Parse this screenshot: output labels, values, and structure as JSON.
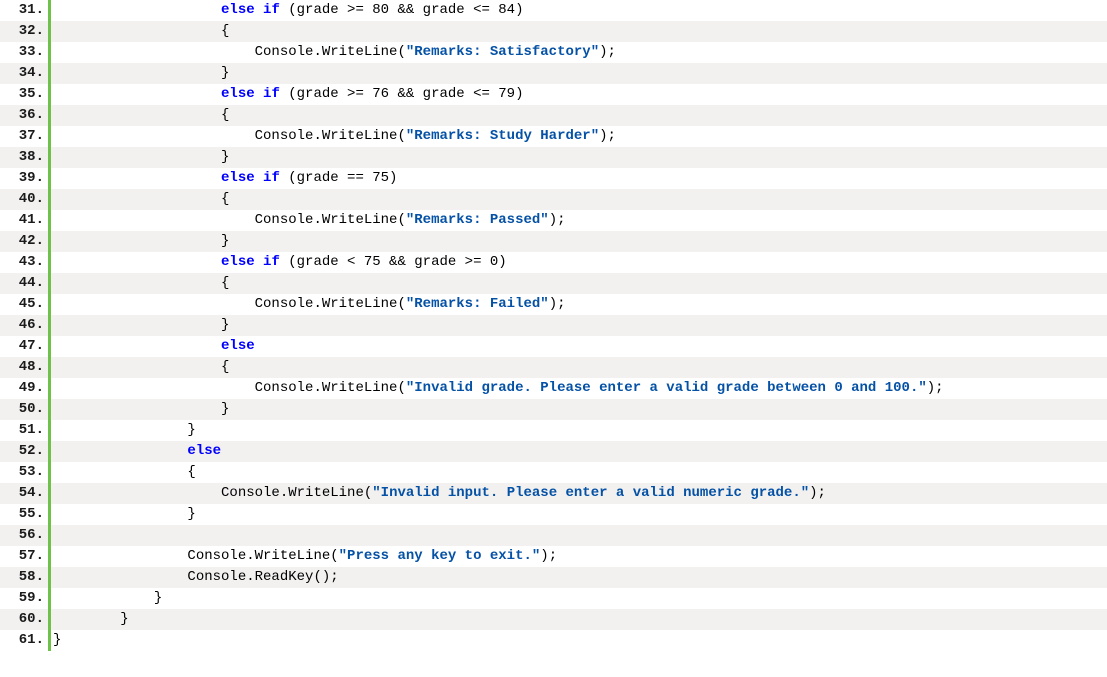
{
  "lines": [
    {
      "n": 31,
      "tokens": [
        [
          "pn",
          "                    "
        ],
        [
          "kw",
          "else if"
        ],
        [
          "pn",
          " (grade >= 80 && grade <= 84)"
        ]
      ]
    },
    {
      "n": 32,
      "tokens": [
        [
          "pn",
          "                    {"
        ]
      ]
    },
    {
      "n": 33,
      "tokens": [
        [
          "pn",
          "                        Console.WriteLine("
        ],
        [
          "str",
          "\"Remarks: Satisfactory\""
        ],
        [
          "pn",
          ");"
        ]
      ]
    },
    {
      "n": 34,
      "tokens": [
        [
          "pn",
          "                    }"
        ]
      ]
    },
    {
      "n": 35,
      "tokens": [
        [
          "pn",
          "                    "
        ],
        [
          "kw",
          "else if"
        ],
        [
          "pn",
          " (grade >= 76 && grade <= 79)"
        ]
      ]
    },
    {
      "n": 36,
      "tokens": [
        [
          "pn",
          "                    {"
        ]
      ]
    },
    {
      "n": 37,
      "tokens": [
        [
          "pn",
          "                        Console.WriteLine("
        ],
        [
          "str",
          "\"Remarks: Study Harder\""
        ],
        [
          "pn",
          ");"
        ]
      ]
    },
    {
      "n": 38,
      "tokens": [
        [
          "pn",
          "                    }"
        ]
      ]
    },
    {
      "n": 39,
      "tokens": [
        [
          "pn",
          "                    "
        ],
        [
          "kw",
          "else if"
        ],
        [
          "pn",
          " (grade == 75)"
        ]
      ]
    },
    {
      "n": 40,
      "tokens": [
        [
          "pn",
          "                    {"
        ]
      ]
    },
    {
      "n": 41,
      "tokens": [
        [
          "pn",
          "                        Console.WriteLine("
        ],
        [
          "str",
          "\"Remarks: Passed\""
        ],
        [
          "pn",
          ");"
        ]
      ]
    },
    {
      "n": 42,
      "tokens": [
        [
          "pn",
          "                    }"
        ]
      ]
    },
    {
      "n": 43,
      "tokens": [
        [
          "pn",
          "                    "
        ],
        [
          "kw",
          "else if"
        ],
        [
          "pn",
          " (grade < 75 && grade >= 0)"
        ]
      ]
    },
    {
      "n": 44,
      "tokens": [
        [
          "pn",
          "                    {"
        ]
      ]
    },
    {
      "n": 45,
      "tokens": [
        [
          "pn",
          "                        Console.WriteLine("
        ],
        [
          "str",
          "\"Remarks: Failed\""
        ],
        [
          "pn",
          ");"
        ]
      ]
    },
    {
      "n": 46,
      "tokens": [
        [
          "pn",
          "                    }"
        ]
      ]
    },
    {
      "n": 47,
      "tokens": [
        [
          "pn",
          "                    "
        ],
        [
          "kw",
          "else"
        ]
      ]
    },
    {
      "n": 48,
      "tokens": [
        [
          "pn",
          "                    {"
        ]
      ]
    },
    {
      "n": 49,
      "tokens": [
        [
          "pn",
          "                        Console.WriteLine("
        ],
        [
          "str",
          "\"Invalid grade. Please enter a valid grade between 0 and 100.\""
        ],
        [
          "pn",
          ");"
        ]
      ]
    },
    {
      "n": 50,
      "tokens": [
        [
          "pn",
          "                    }"
        ]
      ]
    },
    {
      "n": 51,
      "tokens": [
        [
          "pn",
          "                }"
        ]
      ]
    },
    {
      "n": 52,
      "tokens": [
        [
          "pn",
          "                "
        ],
        [
          "kw",
          "else"
        ]
      ]
    },
    {
      "n": 53,
      "tokens": [
        [
          "pn",
          "                {"
        ]
      ]
    },
    {
      "n": 54,
      "tokens": [
        [
          "pn",
          "                    Console.WriteLine("
        ],
        [
          "str",
          "\"Invalid input. Please enter a valid numeric grade.\""
        ],
        [
          "pn",
          ");"
        ]
      ]
    },
    {
      "n": 55,
      "tokens": [
        [
          "pn",
          "                }"
        ]
      ]
    },
    {
      "n": 56,
      "tokens": [
        [
          "pn",
          ""
        ]
      ]
    },
    {
      "n": 57,
      "tokens": [
        [
          "pn",
          "                Console.WriteLine("
        ],
        [
          "str",
          "\"Press any key to exit.\""
        ],
        [
          "pn",
          ");"
        ]
      ]
    },
    {
      "n": 58,
      "tokens": [
        [
          "pn",
          "                Console.ReadKey();"
        ]
      ]
    },
    {
      "n": 59,
      "tokens": [
        [
          "pn",
          "            }"
        ]
      ]
    },
    {
      "n": 60,
      "tokens": [
        [
          "pn",
          "        }"
        ]
      ]
    },
    {
      "n": 61,
      "tokens": [
        [
          "pn",
          "}"
        ]
      ]
    }
  ]
}
